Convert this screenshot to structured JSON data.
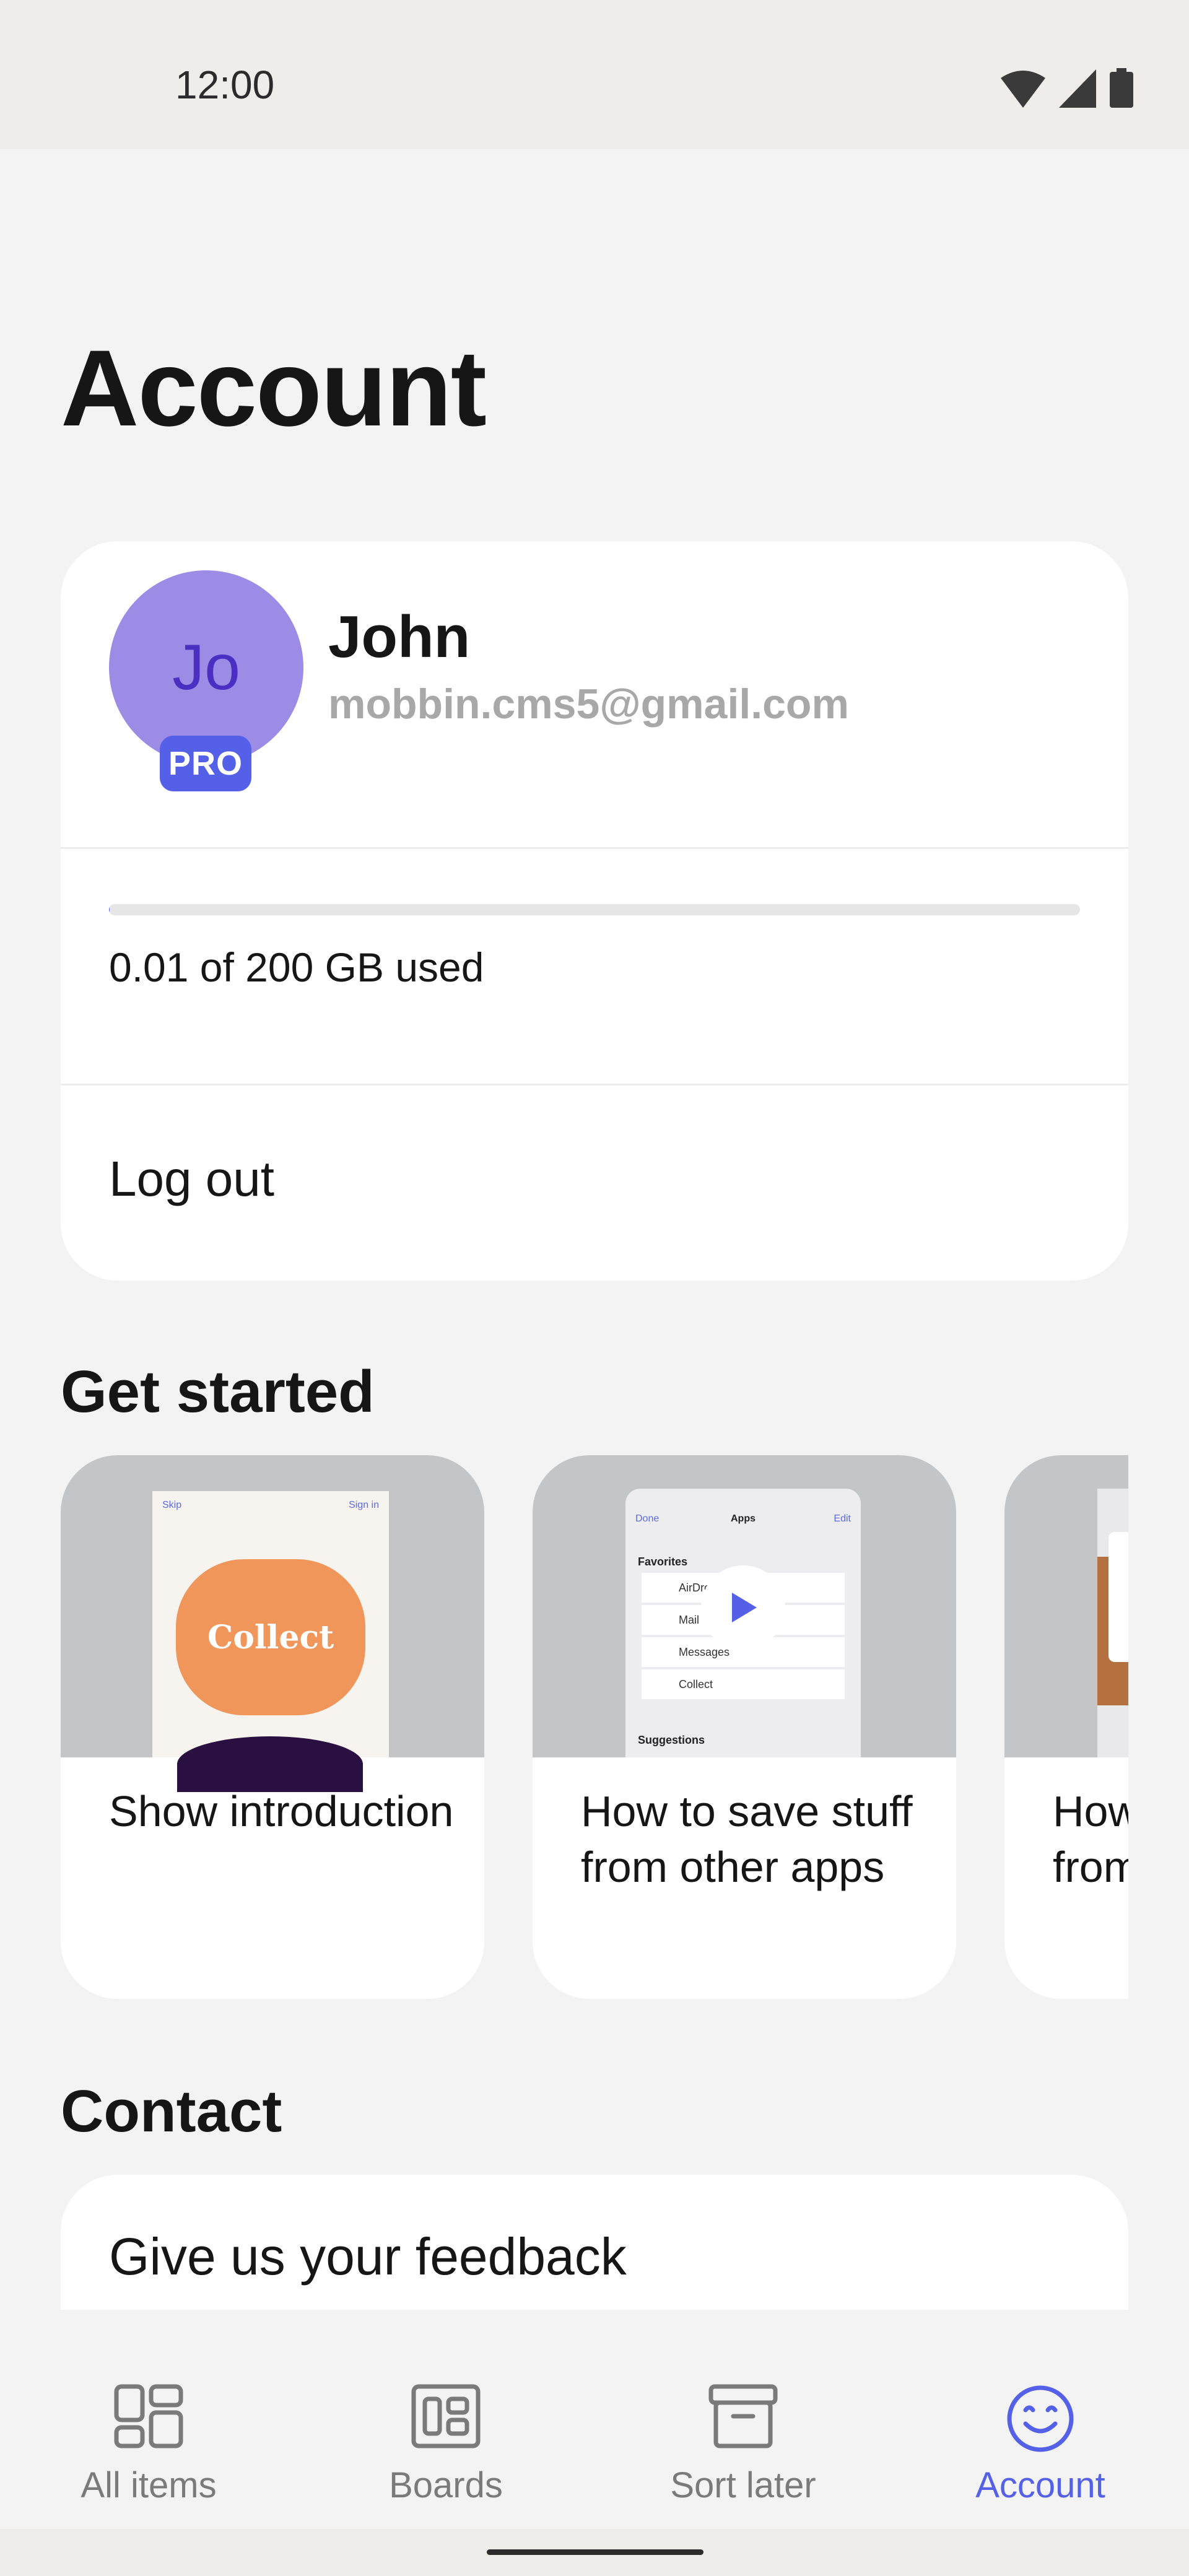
{
  "status_bar": {
    "time": "12:00"
  },
  "page": {
    "title": "Account"
  },
  "profile": {
    "avatar_initials": "Jo",
    "badge": "PRO",
    "name": "John",
    "email": "mobbin.cms5@gmail.com",
    "storage_text": "0.01 of 200 GB used",
    "storage_fraction": 5e-05,
    "logout_label": "Log out"
  },
  "get_started": {
    "title": "Get started",
    "tiles": [
      {
        "label": "Show introduction",
        "thumb_text": "Collect",
        "thumb_left": "Skip",
        "thumb_right": "Sign in"
      },
      {
        "label": "How to save stuff from other apps",
        "thumb_done": "Done",
        "thumb_title": "Apps",
        "thumb_edit": "Edit",
        "thumb_section": "Favorites",
        "thumb_rows": [
          "AirDrop",
          "Mail",
          "Messages",
          "Collect"
        ],
        "thumb_section2": "Suggestions"
      },
      {
        "label": "How to save stuff from Chrome"
      }
    ]
  },
  "contact": {
    "title": "Contact",
    "feedback_label": "Give us your feedback"
  },
  "nav": {
    "items": [
      {
        "label": "All items",
        "icon": "all-items-icon"
      },
      {
        "label": "Boards",
        "icon": "boards-icon"
      },
      {
        "label": "Sort later",
        "icon": "archive-box-icon"
      },
      {
        "label": "Account",
        "icon": "smiley-face-icon"
      }
    ],
    "active": "Account",
    "active_color": "#5560e8"
  }
}
